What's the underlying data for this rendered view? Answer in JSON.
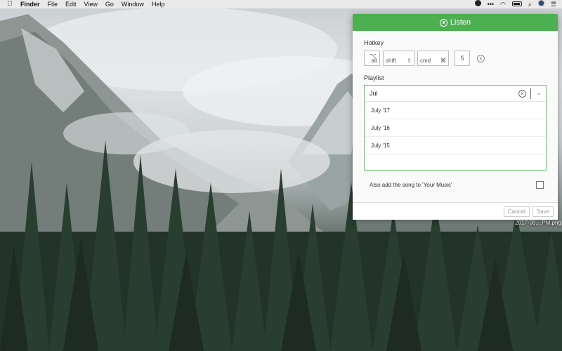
{
  "menubar": {
    "apple_icon": "apple-logo",
    "items": [
      "Finder",
      "File",
      "Edit",
      "View",
      "Go",
      "Window",
      "Help"
    ],
    "status_icons": [
      "listen-icon",
      "more-icon",
      "wifi-icon",
      "battery-icon",
      "search-icon",
      "user-icon",
      "list-icon"
    ]
  },
  "desktop": {
    "file_label": "2017-08....PM.png"
  },
  "panel": {
    "title": "Listen",
    "accent_color": "#4caf50",
    "hotkey": {
      "label": "Hotkey",
      "keys": [
        {
          "label": "alt",
          "symbol": "⌥"
        },
        {
          "label": "shift",
          "symbol": "⇧"
        },
        {
          "label": "cmd",
          "symbol": "⌘"
        }
      ],
      "key_value": "5",
      "clear_symbol": "×"
    },
    "playlist": {
      "label": "Playlist",
      "input_value": "Jul",
      "clear_symbol": "×",
      "chevron": "⌄",
      "options": [
        "July '17",
        "July '16",
        "July '15"
      ]
    },
    "also_add": {
      "label": "Also add the song to 'Your Music'",
      "checked": false
    },
    "buttons": {
      "cancel": "Cancel",
      "save": "Save"
    }
  }
}
